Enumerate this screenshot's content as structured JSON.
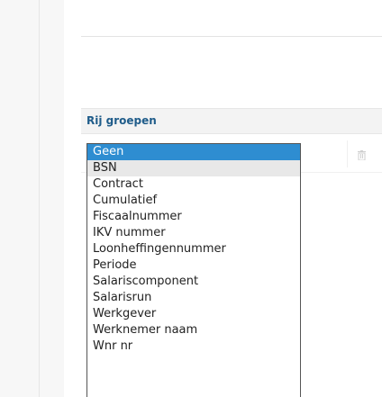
{
  "panel": {
    "title": "Rij groepen"
  },
  "icons": {
    "delete": "trash-icon"
  },
  "dropdown": {
    "selected": "Geen",
    "options": [
      "Geen",
      "BSN",
      "Contract",
      "Cumulatief",
      "Fiscaalnummer",
      "IKV nummer",
      "Loonheffingennummer",
      "Periode",
      "Salariscomponent",
      "Salarisrun",
      "Werkgever",
      "Werknemer naam",
      "Wnr nr"
    ]
  },
  "colors": {
    "header_text": "#1f5c8a",
    "selected_bg": "#2e8dd1",
    "hover_bg": "#e8e8e8"
  }
}
